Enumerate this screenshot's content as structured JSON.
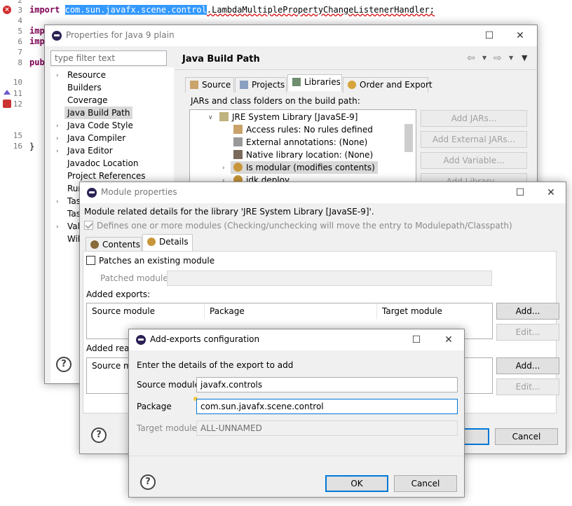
{
  "editor": {
    "lines": [
      {
        "num": "2",
        "code": ""
      },
      {
        "num": "3",
        "code": "import com.sun.javafx.scene.control.LambdaMultiplePropertyChangeListenerHandler;"
      },
      {
        "num": "4",
        "code": ""
      },
      {
        "num": "5",
        "code": "imp"
      },
      {
        "num": "6",
        "code": "imp"
      },
      {
        "num": "7",
        "code": ""
      },
      {
        "num": "8",
        "code": "pub"
      },
      {
        "num": "10",
        "code": ""
      },
      {
        "num": "11",
        "code": ""
      },
      {
        "num": "12",
        "code": ""
      },
      {
        "num": "15",
        "code": ""
      },
      {
        "num": "16",
        "code": "}"
      }
    ],
    "import_kw": "import",
    "import_pkg": "com.sun.javafx.scene.control",
    "import_rest": ".LambdaMultiplePropertyChangeListenerHandler;",
    "imp5": "imp",
    "imp6": "imp",
    "pub": "pub",
    "brace": "}"
  },
  "properties_dialog": {
    "title": "Properties for Java 9 plain",
    "filter_placeholder": "type filter text",
    "nav_items": [
      "Resource",
      "Builders",
      "Coverage",
      "Java Build Path",
      "Java Code Style",
      "Java Compiler",
      "Java Editor",
      "Javadoc Location",
      "Project References",
      "Run",
      "Task",
      "Task",
      "Vali",
      "Wik"
    ],
    "page_title": "Java Build Path",
    "tabs": [
      "Source",
      "Projects",
      "Libraries",
      "Order and Export"
    ],
    "jars_label": "JARs and class folders on the build path:",
    "tree": [
      "JRE System Library [JavaSE-9]",
      "Access rules: No rules defined",
      "External annotations: (None)",
      "Native library location: (None)",
      "Is modular (modifies contents)",
      "jdk.deploy"
    ],
    "buttons": [
      "Add JARs...",
      "Add External JARs...",
      "Add Variable...",
      "Add Library..."
    ]
  },
  "module_dialog": {
    "title": "Module properties",
    "description": "Module related details for the library 'JRE System Library [JavaSE-9]'.",
    "defines_modules": "Defines one or more modules (Checking/unchecking will move the entry to Modulepath/Classpath)",
    "tabs": [
      "Contents",
      "Details"
    ],
    "patches_label": "Patches an existing module",
    "patched_module_label": "Patched module:",
    "added_exports_label": "Added exports:",
    "exports_columns": [
      "Source module",
      "Package",
      "Target module"
    ],
    "added_reads_label": "Added read",
    "reads_columns": [
      "Source mo"
    ],
    "add_button": "Add...",
    "edit_button": "Edit...",
    "cancel_button": "Cancel"
  },
  "exports_dialog": {
    "title": "Add-exports configuration",
    "instruction": "Enter the details of the export to add",
    "source_module_label": "Source module",
    "source_module_value": "javafx.controls",
    "package_label": "Package",
    "package_value": "com.sun.javafx.scene.control",
    "target_module_label": "Target module",
    "target_module_value": "ALL-UNNAMED",
    "ok_button": "OK",
    "cancel_button": "Cancel"
  }
}
